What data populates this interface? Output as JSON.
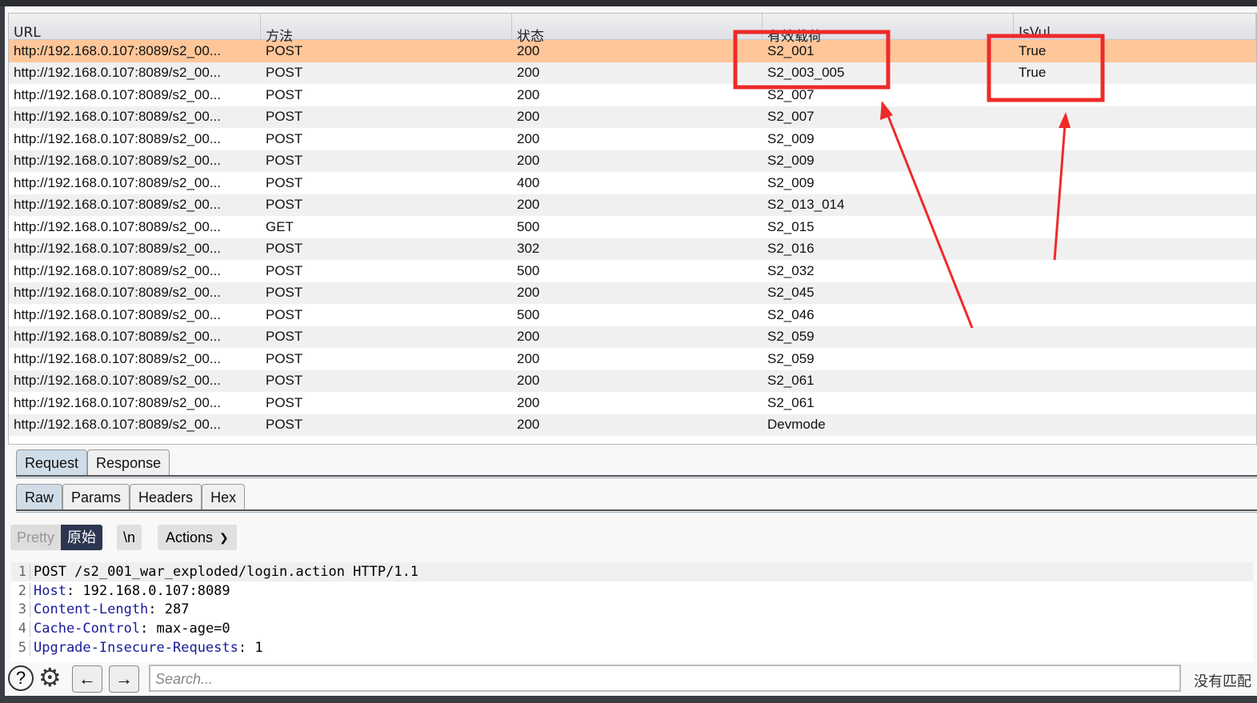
{
  "table": {
    "columns": [
      "URL",
      "方法",
      "状态",
      "有效载荷",
      "IsVul"
    ],
    "rows": [
      [
        "http://192.168.0.107:8089/s2_00...",
        "POST",
        "200",
        "S2_001",
        "True"
      ],
      [
        "http://192.168.0.107:8089/s2_00...",
        "POST",
        "200",
        "S2_003_005",
        "True"
      ],
      [
        "http://192.168.0.107:8089/s2_00...",
        "POST",
        "200",
        "S2_007",
        ""
      ],
      [
        "http://192.168.0.107:8089/s2_00...",
        "POST",
        "200",
        "S2_007",
        ""
      ],
      [
        "http://192.168.0.107:8089/s2_00...",
        "POST",
        "200",
        "S2_009",
        ""
      ],
      [
        "http://192.168.0.107:8089/s2_00...",
        "POST",
        "200",
        "S2_009",
        ""
      ],
      [
        "http://192.168.0.107:8089/s2_00...",
        "POST",
        "400",
        "S2_009",
        ""
      ],
      [
        "http://192.168.0.107:8089/s2_00...",
        "POST",
        "200",
        "S2_013_014",
        ""
      ],
      [
        "http://192.168.0.107:8089/s2_00...",
        "GET",
        "500",
        "S2_015",
        ""
      ],
      [
        "http://192.168.0.107:8089/s2_00...",
        "POST",
        "302",
        "S2_016",
        ""
      ],
      [
        "http://192.168.0.107:8089/s2_00...",
        "POST",
        "500",
        "S2_032",
        ""
      ],
      [
        "http://192.168.0.107:8089/s2_00...",
        "POST",
        "200",
        "S2_045",
        ""
      ],
      [
        "http://192.168.0.107:8089/s2_00...",
        "POST",
        "500",
        "S2_046",
        ""
      ],
      [
        "http://192.168.0.107:8089/s2_00...",
        "POST",
        "200",
        "S2_059",
        ""
      ],
      [
        "http://192.168.0.107:8089/s2_00...",
        "POST",
        "200",
        "S2_059",
        ""
      ],
      [
        "http://192.168.0.107:8089/s2_00...",
        "POST",
        "200",
        "S2_061",
        ""
      ],
      [
        "http://192.168.0.107:8089/s2_00...",
        "POST",
        "200",
        "S2_061",
        ""
      ],
      [
        "http://192.168.0.107:8089/s2_00...",
        "POST",
        "200",
        "Devmode",
        ""
      ]
    ],
    "selected_row": 0,
    "selected_color": "#fec699"
  },
  "tabs": {
    "main": [
      "Request",
      "Response"
    ],
    "sub": [
      "Raw",
      "Params",
      "Headers",
      "Hex"
    ]
  },
  "toolbar": {
    "pretty": "Pretty",
    "raw": "原始",
    "newline": "\\n",
    "actions": "Actions"
  },
  "code": [
    {
      "n": "1",
      "key": "",
      "val": "POST /s2_001_war_exploded/login.action HTTP/1.1"
    },
    {
      "n": "2",
      "key": "Host",
      "val": ": 192.168.0.107:8089"
    },
    {
      "n": "3",
      "key": "Content-Length",
      "val": ": 287"
    },
    {
      "n": "4",
      "key": "Cache-Control",
      "val": ": max-age=0"
    },
    {
      "n": "5",
      "key": "Upgrade-Insecure-Requests",
      "val": ": 1"
    }
  ],
  "search": {
    "placeholder": "Search...",
    "status": "没有匹配"
  },
  "annotation_color": "#ee2a2a"
}
